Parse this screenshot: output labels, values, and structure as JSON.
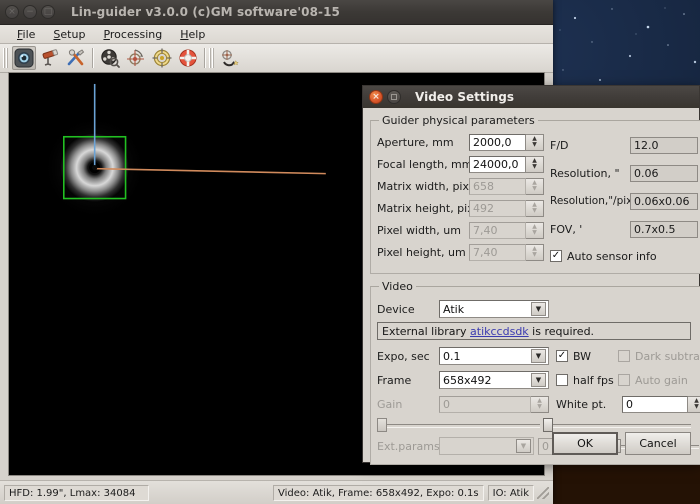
{
  "desktop": {
    "wallpaper": "starfield-night-landscape"
  },
  "main_window": {
    "title": "Lin-guider v3.0.0 (c)GM software'08-15",
    "window_buttons": [
      {
        "name": "close",
        "glyph": "×"
      },
      {
        "name": "minimize",
        "glyph": "−"
      },
      {
        "name": "maximize",
        "glyph": "□"
      }
    ],
    "menubar": [
      {
        "label": "File",
        "mnemonic": "F"
      },
      {
        "label": "Setup",
        "mnemonic": "S"
      },
      {
        "label": "Processing",
        "mnemonic": "P"
      },
      {
        "label": "Help",
        "mnemonic": "H"
      }
    ],
    "toolbar": [
      {
        "name": "camera-icon",
        "tooltip": "Camera / video device",
        "active": true
      },
      {
        "name": "telescope-icon",
        "tooltip": "Telescope"
      },
      {
        "name": "tools-icon",
        "tooltip": "Settings / tools"
      },
      {
        "name": "film-reel-search-icon",
        "tooltip": "Device search"
      },
      {
        "name": "calibration-target-icon",
        "tooltip": "Calibration"
      },
      {
        "name": "guiding-target-icon",
        "tooltip": "Guiding"
      },
      {
        "name": "lifebuoy-icon",
        "tooltip": "Drift / lifebuoy"
      },
      {
        "name": "star-rotate-icon",
        "tooltip": "Rotate frame"
      }
    ],
    "canvas": {
      "name": "guider-video-canvas",
      "reticle_color": "#22c022",
      "axis_ra_color": "#6ba3d6",
      "axis_dec_color": "#d08a5c",
      "background": "#000000"
    },
    "statusbar": {
      "hfd": "HFD: 1.99\", Lmax: 34084",
      "video": "Video: Atik, Frame: 658x492, Expo: 0.1s",
      "io": "IO: Atik"
    }
  },
  "dialog": {
    "title": "Video Settings",
    "window_buttons": [
      {
        "name": "close",
        "glyph": "×"
      },
      {
        "name": "maximize",
        "glyph": "□"
      }
    ],
    "physical": {
      "legend": "Guider physical parameters",
      "fields": [
        {
          "label": "Aperture, mm",
          "value": "2000,0",
          "disabled": false
        },
        {
          "label": "Focal length, mm",
          "value": "24000,0",
          "disabled": false
        },
        {
          "label": "Matrix width, pix",
          "value": "658",
          "disabled": true
        },
        {
          "label": "Matrix height, pix",
          "value": "492",
          "disabled": true
        },
        {
          "label": "Pixel width, um",
          "value": "7,40",
          "disabled": true
        },
        {
          "label": "Pixel height, um",
          "value": "7,40",
          "disabled": true
        }
      ],
      "readouts": [
        {
          "label": "F/D",
          "value": "12.0"
        },
        {
          "label": "Resolution, \"",
          "value": "0.06"
        },
        {
          "label": "Resolution,\"/pix",
          "value": "0.06x0.06"
        },
        {
          "label": "FOV, '",
          "value": "0.7x0.5"
        }
      ],
      "auto_sensor": {
        "label": "Auto sensor info",
        "checked": true
      }
    },
    "video": {
      "legend": "Video",
      "device_label": "Device",
      "device_value": "Atik",
      "note_prefix": "External library ",
      "note_link": "atikccdsdk",
      "note_suffix": " is required.",
      "expo_label": "Expo, sec",
      "expo_value": "0.1",
      "frame_label": "Frame",
      "frame_value": "658x492",
      "bw": {
        "label": "BW",
        "checked": true,
        "disabled": false
      },
      "half_fps": {
        "label": "half fps",
        "checked": false,
        "disabled": false
      },
      "dark_subtract": {
        "label": "Dark subtract",
        "checked": false,
        "disabled": true
      },
      "auto_gain": {
        "label": "Auto gain",
        "checked": false,
        "disabled": true
      },
      "gain_label": "Gain",
      "gain_value": "0",
      "gain_disabled": true,
      "white_pt_label": "White pt.",
      "white_pt_value": "0",
      "ext_params_label": "Ext.params",
      "ext_params_value": "",
      "ext_params_number": "0"
    },
    "buttons": {
      "ok": "OK",
      "cancel": "Cancel"
    }
  }
}
